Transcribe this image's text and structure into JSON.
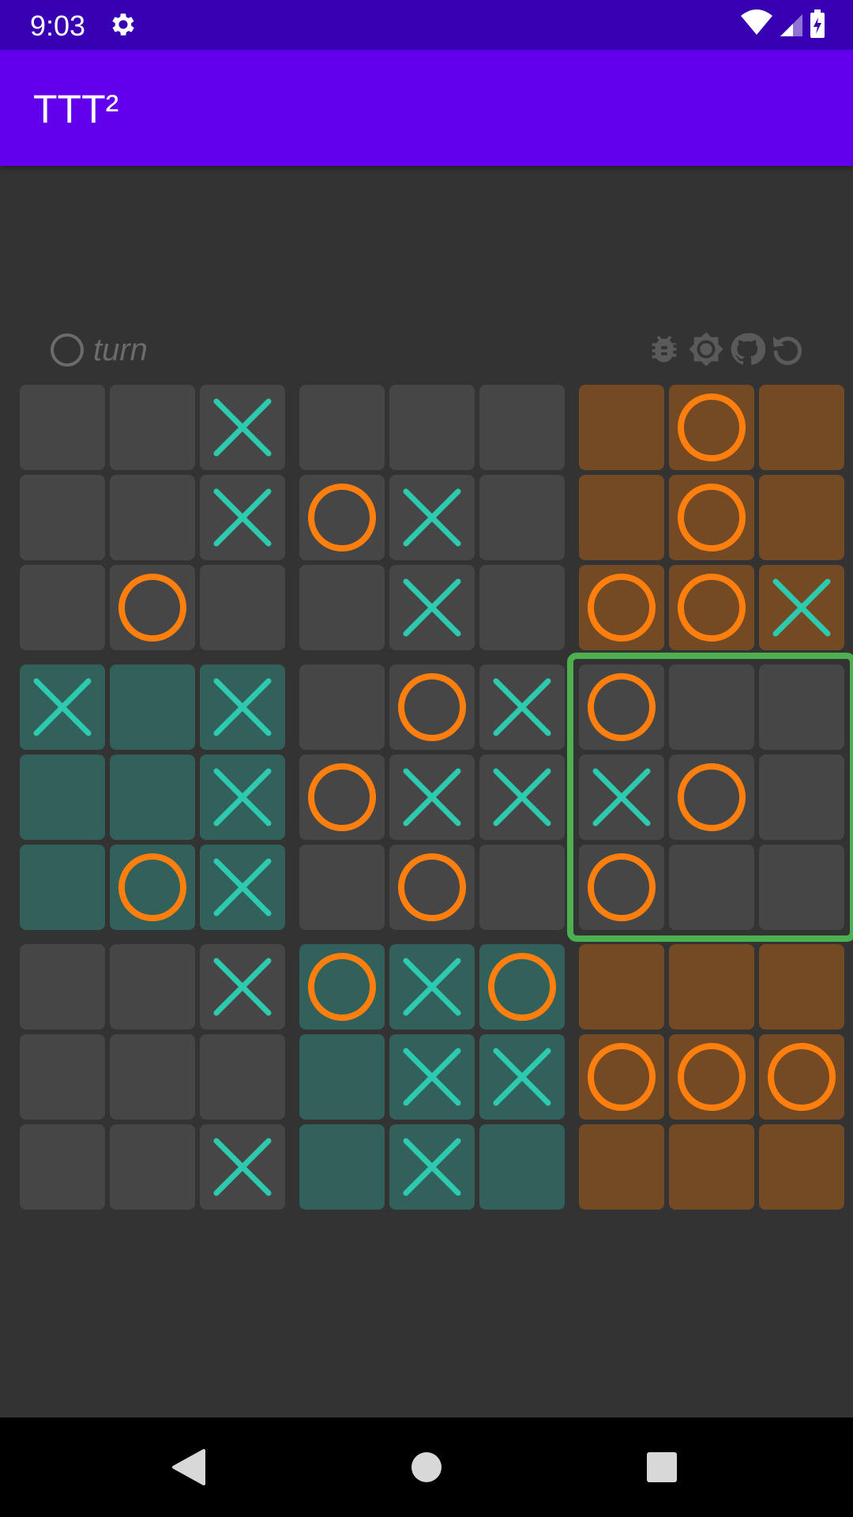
{
  "status_bar": {
    "time": "9:03"
  },
  "app_bar": {
    "title": "TTT²"
  },
  "turn": {
    "text": "turn",
    "player": "O"
  },
  "toolbar": [
    "bug-icon",
    "brightness-icon",
    "github-icon",
    "undo-icon"
  ],
  "colors": {
    "status_bar": "#3700b3",
    "app_bar": "#6200ee",
    "background": "#333333",
    "cell_empty": "#464646",
    "cell_x_won": "#32605a",
    "cell_o_won": "#734a24",
    "x_mark": "#2ecab0",
    "o_mark": "#ff7f0e",
    "active_board": "#4caf50"
  },
  "board": {
    "active_subboard": {
      "row": 1,
      "col": 2
    },
    "subboard_winners": [
      [
        "",
        "",
        "O"
      ],
      [
        "X",
        "",
        ""
      ],
      [
        "",
        "X",
        "O"
      ]
    ],
    "cells": [
      [
        "",
        "",
        "X",
        "",
        "",
        "",
        "",
        "O",
        ""
      ],
      [
        "",
        "",
        "X",
        "O",
        "X",
        "",
        "",
        "O",
        ""
      ],
      [
        "",
        "O",
        "",
        "",
        "X",
        "",
        "O",
        "O",
        "X"
      ],
      [
        "X",
        "",
        "X",
        "",
        "O",
        "X",
        "O",
        "",
        ""
      ],
      [
        "",
        "",
        "X",
        "O",
        "X",
        "X",
        "X",
        "O",
        ""
      ],
      [
        "",
        "O",
        "X",
        "",
        "O",
        "",
        "O",
        "",
        ""
      ],
      [
        "",
        "",
        "X",
        "O",
        "X",
        "O",
        "",
        "",
        ""
      ],
      [
        "",
        "",
        "",
        "",
        "X",
        "X",
        "O",
        "O",
        "O"
      ],
      [
        "",
        "",
        "X",
        "",
        "X",
        "",
        "",
        "",
        ""
      ]
    ]
  },
  "nav": [
    "back-icon",
    "home-icon",
    "recents-icon"
  ]
}
